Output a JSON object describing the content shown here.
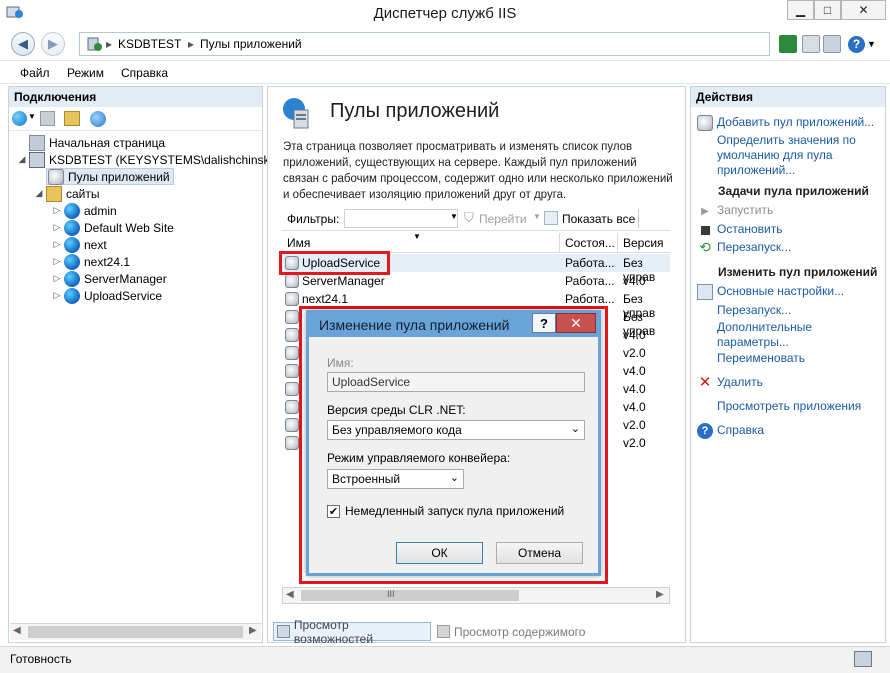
{
  "window": {
    "title": "Диспетчер служб IIS",
    "min": "▁",
    "max": "□",
    "close": "✕"
  },
  "address": {
    "segments": [
      "KSDBTEST",
      "Пулы приложений"
    ],
    "sep": "▸"
  },
  "menu": [
    "Файл",
    "Режим",
    "Справка"
  ],
  "left": {
    "header": "Подключения",
    "tree": [
      {
        "label": "Начальная страница",
        "level": 0
      },
      {
        "label": "KSDBTEST (KEYSYSTEMS\\dalishchinskaya)",
        "level": 0
      },
      {
        "label": "Пулы приложений",
        "level": 1
      },
      {
        "label": "сайты",
        "level": 1
      },
      {
        "label": "admin",
        "level": 2
      },
      {
        "label": "Default Web Site",
        "level": 2
      },
      {
        "label": "next",
        "level": 2
      },
      {
        "label": "next24.1",
        "level": 2
      },
      {
        "label": "ServerManager",
        "level": 2
      },
      {
        "label": "UploadService",
        "level": 2
      }
    ]
  },
  "center": {
    "title": "Пулы приложений",
    "description": "Эта страница позволяет просматривать и изменять список пулов приложений, существующих на сервере. Каждый пул приложений связан с рабочим процессом, содержит одно или несколько приложений и обеспечивает изоляцию приложений друг от друга.",
    "filter_label": "Фильтры:",
    "go_label": "Перейти",
    "show_all_label": "Показать все",
    "columns": [
      "Имя",
      "Состоя...",
      "Версия с"
    ],
    "rows": [
      {
        "name": "UploadService",
        "state": "Работа...",
        "version": "Без управ"
      },
      {
        "name": "ServerManager",
        "state": "Работа...",
        "version": "v4.0"
      },
      {
        "name": "next24.1",
        "state": "Работа...",
        "version": "Без управ"
      },
      {
        "name": "",
        "state": "",
        "version": "Без управ"
      },
      {
        "name": "",
        "state": "",
        "version": "v4.0"
      },
      {
        "name": "",
        "state": "",
        "version": "v2.0"
      },
      {
        "name": "",
        "state": "",
        "version": "v4.0"
      },
      {
        "name": "",
        "state": "",
        "version": "v4.0"
      },
      {
        "name": "",
        "state": "",
        "version": "v4.0"
      },
      {
        "name": "",
        "state": "",
        "version": "v2.0"
      },
      {
        "name": "",
        "state": "",
        "version": "v2.0"
      }
    ],
    "scroll_thumb": "III",
    "tab_features": "Просмотр возможностей",
    "tab_content": "Просмотр содержимого"
  },
  "right": {
    "header": "Действия",
    "add_pool": "Добавить пул приложений...",
    "set_defaults": "Определить значения по умолчанию для пула приложений...",
    "tasks_head": "Задачи пула приложений",
    "start": "Запустить",
    "stop": "Остановить",
    "recycle": "Перезапуск...",
    "edit_head": "Изменить пул приложений",
    "basic": "Основные настройки...",
    "recycling": "Перезапуск...",
    "advanced": "Дополнительные параметры...",
    "rename": "Переименовать",
    "delete": "Удалить",
    "view_apps": "Просмотреть приложения",
    "help": "Справка"
  },
  "status": {
    "text": "Готовность"
  },
  "dialog": {
    "title": "Изменение пула приложений",
    "help": "?",
    "close": "✕",
    "name_label": "Имя:",
    "name_value": "UploadService",
    "clr_label": "Версия среды CLR .NET:",
    "clr_value": "Без управляемого кода",
    "pipeline_label": "Режим управляемого конвейера:",
    "pipeline_value": "Встроенный",
    "autostart_label": "Немедленный запуск пула приложений",
    "autostart_checked": true,
    "ok": "ОК",
    "cancel": "Отмена"
  },
  "colors": {
    "accent": "#1a5aa6",
    "highlight": "#e4161e",
    "dialog_border": "#6aa3d8"
  }
}
